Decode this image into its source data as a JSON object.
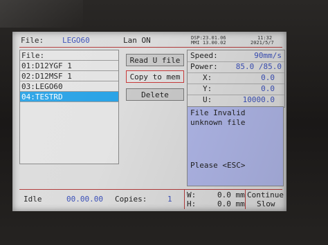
{
  "header": {
    "file_label": "File:",
    "file_name": "LEGO60",
    "lan_status": "Lan ON",
    "dsp_version": "DSP:23.01.06",
    "mmi_version": "MMI 13.00.02",
    "time": "11:32",
    "date": "2021/5/7"
  },
  "file_list": {
    "header": "File:",
    "items": [
      {
        "label": "01:D12YGF 1",
        "selected": false
      },
      {
        "label": "02:D12MSF 1",
        "selected": false
      },
      {
        "label": "03:LEGO60",
        "selected": false
      },
      {
        "label": "04:TESTRD",
        "selected": true
      }
    ]
  },
  "buttons": {
    "read_u_file": "Read U file",
    "copy_to_mem": "Copy to mem",
    "delete": "Delete"
  },
  "params": {
    "speed_label": "Speed:",
    "speed_value": "90mm/s",
    "power_label": "Power:",
    "power_value": "85.0 /85.0",
    "x_label": "X:",
    "x_value": "0.0",
    "y_label": "Y:",
    "y_value": "0.0",
    "u_label": "U:",
    "u_value": "10000.0"
  },
  "message": {
    "line1": "File Invalid",
    "line2": "unknown file",
    "prompt": "Please <ESC>"
  },
  "status": {
    "state": "Idle",
    "elapsed": "00.00.00",
    "copies_label": "Copies:",
    "copies_value": "1",
    "w_label": "W:",
    "w_value": "0.0 mm",
    "h_label": "H:",
    "h_value": "0.0 mm",
    "mode1": "Continue",
    "mode2": "Slow"
  },
  "colors": {
    "selection": "#2aa3e6",
    "message_panel": "#aeb5e6",
    "value_text": "#3a4fb8",
    "divider": "#b23a3a"
  }
}
